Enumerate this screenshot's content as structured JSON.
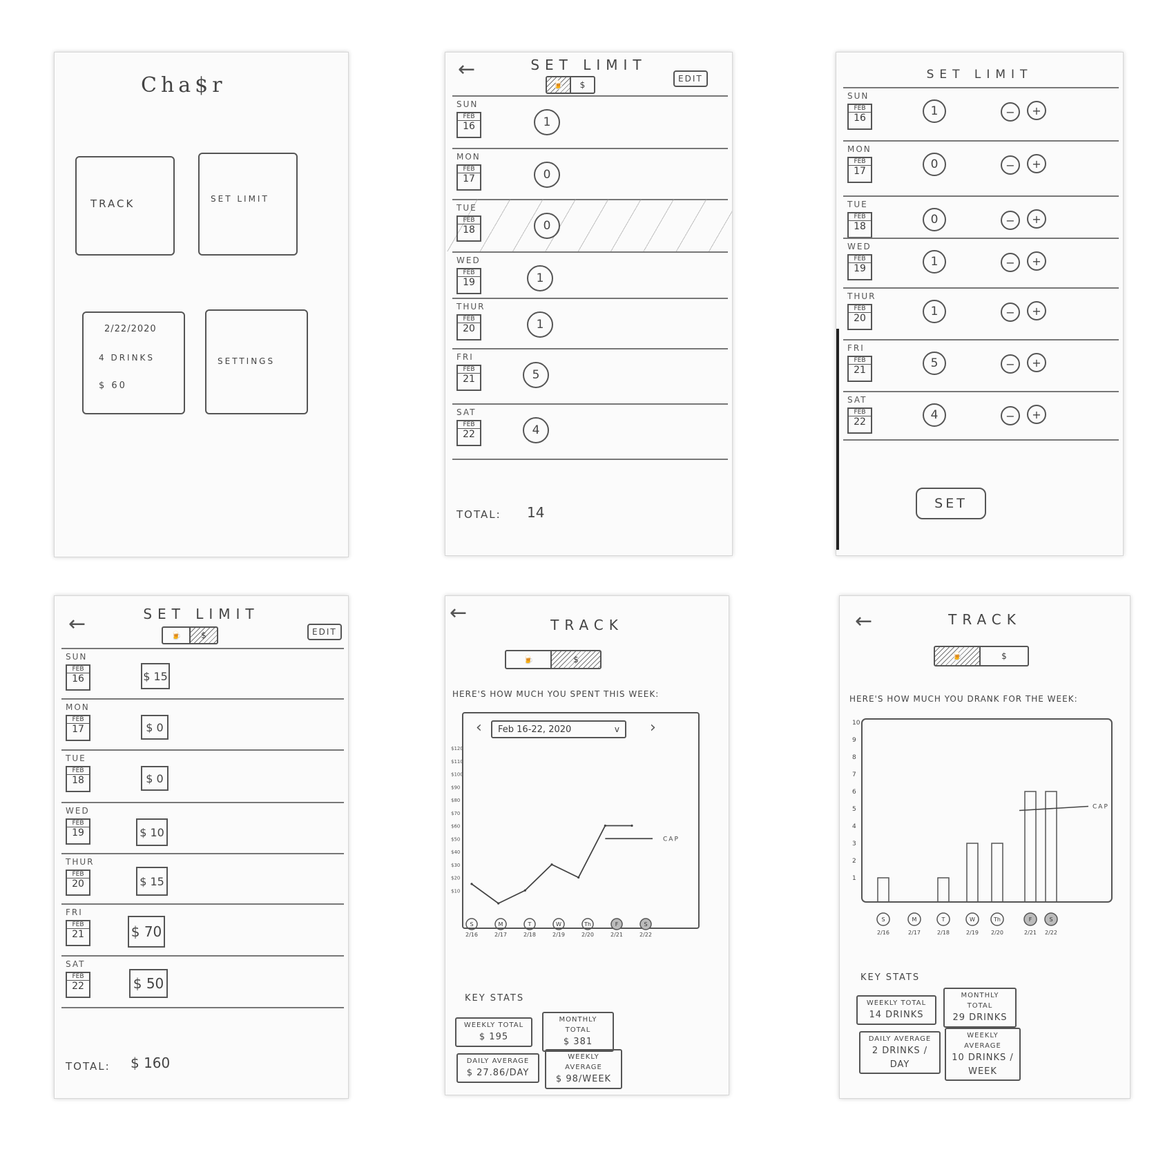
{
  "home": {
    "app_title": "Cha$r",
    "track_label": "TRACK",
    "set_limit_label": "SET LIMIT",
    "summary_date": "2/22/2020",
    "summary_drinks": "4 DRINKS",
    "summary_money": "$ 60",
    "settings_label": "SETTINGS"
  },
  "set_limit_drinks": {
    "title": "SET LIMIT",
    "edit": "EDIT",
    "toggle_drinks": "🍺",
    "toggle_money": "$",
    "days": [
      {
        "name": "SUN",
        "month": "FEB",
        "date": "16",
        "value": "1"
      },
      {
        "name": "MON",
        "month": "FEB",
        "date": "17",
        "value": "0"
      },
      {
        "name": "TUE",
        "month": "FEB",
        "date": "18",
        "value": "0"
      },
      {
        "name": "WED",
        "month": "FEB",
        "date": "19",
        "value": "1"
      },
      {
        "name": "THUR",
        "month": "FEB",
        "date": "20",
        "value": "1"
      },
      {
        "name": "FRI",
        "month": "FEB",
        "date": "21",
        "value": "5"
      },
      {
        "name": "SAT",
        "month": "FEB",
        "date": "22",
        "value": "4"
      }
    ],
    "total_label": "TOTAL:",
    "total_value": "14"
  },
  "set_limit_edit": {
    "title": "SET LIMIT",
    "minus": "−",
    "plus": "+",
    "set_button": "SET",
    "days": [
      {
        "name": "SUN",
        "month": "FEB",
        "date": "16",
        "value": "1"
      },
      {
        "name": "MON",
        "month": "FEB",
        "date": "17",
        "value": "0"
      },
      {
        "name": "TUE",
        "month": "FEB",
        "date": "18",
        "value": "0"
      },
      {
        "name": "WED",
        "month": "FEB",
        "date": "19",
        "value": "1"
      },
      {
        "name": "THUR",
        "month": "FEB",
        "date": "20",
        "value": "1"
      },
      {
        "name": "FRI",
        "month": "FEB",
        "date": "21",
        "value": "5"
      },
      {
        "name": "SAT",
        "month": "FEB",
        "date": "22",
        "value": "4"
      }
    ]
  },
  "set_limit_money": {
    "title": "SET LIMIT",
    "edit": "EDIT",
    "toggle_drinks": "🍺",
    "toggle_money": "$",
    "days": [
      {
        "name": "SUN",
        "month": "FEB",
        "date": "16",
        "value": "$ 15"
      },
      {
        "name": "MON",
        "month": "FEB",
        "date": "17",
        "value": "$ 0"
      },
      {
        "name": "TUE",
        "month": "FEB",
        "date": "18",
        "value": "$ 0"
      },
      {
        "name": "WED",
        "month": "FEB",
        "date": "19",
        "value": "$ 10"
      },
      {
        "name": "THUR",
        "month": "FEB",
        "date": "20",
        "value": "$ 15"
      },
      {
        "name": "FRI",
        "month": "FEB",
        "date": "21",
        "value": "$ 70"
      },
      {
        "name": "SAT",
        "month": "FEB",
        "date": "22",
        "value": "$ 50"
      }
    ],
    "total_label": "TOTAL:",
    "total_value": "$ 160"
  },
  "track_money": {
    "title": "TRACK",
    "toggle_drinks": "🍺",
    "toggle_money": "$",
    "heading": "HERE'S HOW MUCH YOU SPENT THIS WEEK:",
    "date_range": "Feb 16-22, 2020",
    "prev": "‹",
    "next": "›",
    "cap_label": "CAP",
    "key_stats_label": "KEY STATS",
    "stats": [
      {
        "label": "WEEKLY TOTAL",
        "value": "$ 195"
      },
      {
        "label": "MONTHLY TOTAL",
        "value": "$ 381"
      },
      {
        "label": "DAILY AVERAGE",
        "value": "$ 27.86/DAY"
      },
      {
        "label": "WEEKLY AVERAGE",
        "value": "$ 98/WEEK"
      }
    ]
  },
  "track_drinks": {
    "title": "TRACK",
    "toggle_drinks": "🍺",
    "toggle_money": "$",
    "heading": "HERE'S HOW MUCH YOU DRANK FOR THE WEEK:",
    "cap_label": "CAP",
    "key_stats_label": "KEY STATS",
    "stats": [
      {
        "label": "WEEKLY TOTAL",
        "value": "14 DRINKS"
      },
      {
        "label": "MONTHLY TOTAL",
        "value": "29 DRINKS"
      },
      {
        "label": "DAILY AVERAGE",
        "value": "2 DRINKS / DAY"
      },
      {
        "label": "WEEKLY AVERAGE",
        "value": "10 DRINKS / WEEK"
      }
    ]
  },
  "chart_data": [
    {
      "type": "line",
      "x": [
        "2/16",
        "2/17",
        "2/18",
        "2/19",
        "2/20",
        "2/21",
        "2/22"
      ],
      "day_initials": [
        "S",
        "M",
        "T",
        "W",
        "Th",
        "F",
        "S"
      ],
      "series": [
        {
          "values": [
            15,
            0,
            10,
            30,
            20,
            60,
            60
          ]
        }
      ],
      "y_ticks": [
        10,
        20,
        30,
        40,
        50,
        60,
        70,
        80,
        90,
        100,
        110,
        120
      ],
      "ylim": [
        0,
        120
      ],
      "cap_label": "CAP",
      "cap_value": 50
    },
    {
      "type": "bar",
      "categories": [
        "2/16",
        "2/17",
        "2/18",
        "2/19",
        "2/20",
        "2/21",
        "2/22"
      ],
      "day_initials": [
        "S",
        "M",
        "T",
        "W",
        "Th",
        "F",
        "S"
      ],
      "values": [
        1,
        0,
        1,
        3,
        3,
        6,
        6
      ],
      "y_ticks": [
        1,
        2,
        3,
        4,
        5,
        6,
        7,
        8,
        9,
        10
      ],
      "ylim": [
        0,
        10
      ],
      "cap_label": "CAP",
      "cap_value": 4.9
    }
  ]
}
